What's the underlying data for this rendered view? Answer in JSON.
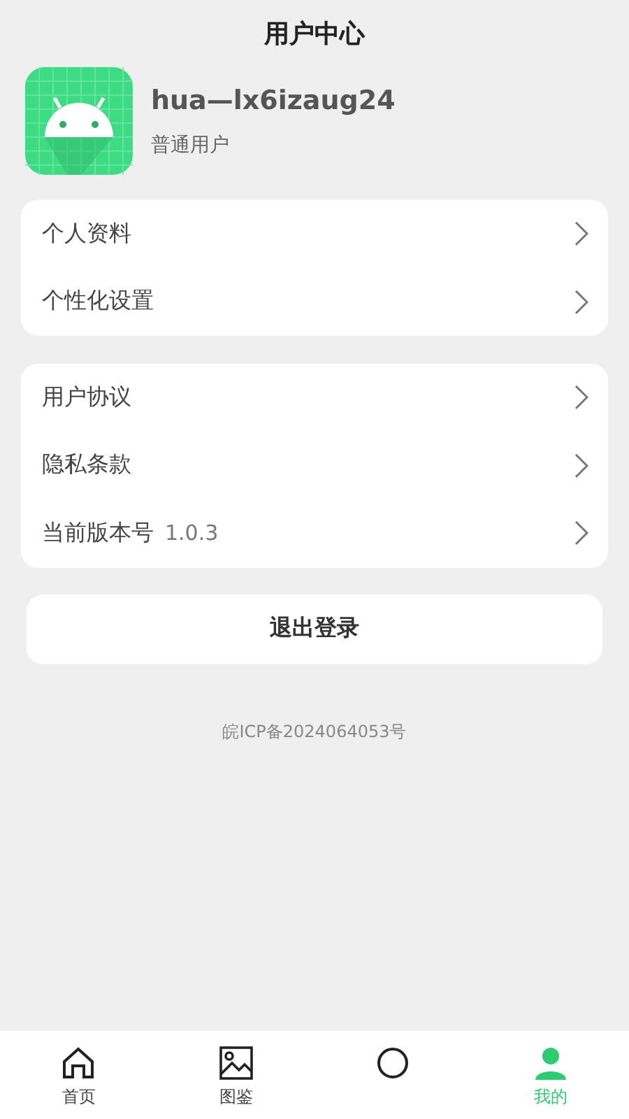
{
  "header": {
    "title": "用户中心"
  },
  "profile": {
    "name": "hua—lx6izaug24",
    "role": "普通用户"
  },
  "groups": [
    {
      "items": [
        {
          "label": "个人资料"
        },
        {
          "label": "个性化设置"
        }
      ]
    },
    {
      "items": [
        {
          "label": "用户协议"
        },
        {
          "label": "隐私条款"
        },
        {
          "label": "当前版本号",
          "value": "1.0.3"
        }
      ]
    }
  ],
  "logout_button": "退出登录",
  "footer": "皖ICP备2024064053号",
  "bottom_nav": [
    {
      "kind": "home",
      "label": "首页",
      "selected": false
    },
    {
      "kind": "image",
      "label": "图鉴",
      "selected": false
    },
    {
      "kind": "circle",
      "selected": false
    },
    {
      "kind": "person",
      "label": "我的",
      "selected": true
    }
  ]
}
